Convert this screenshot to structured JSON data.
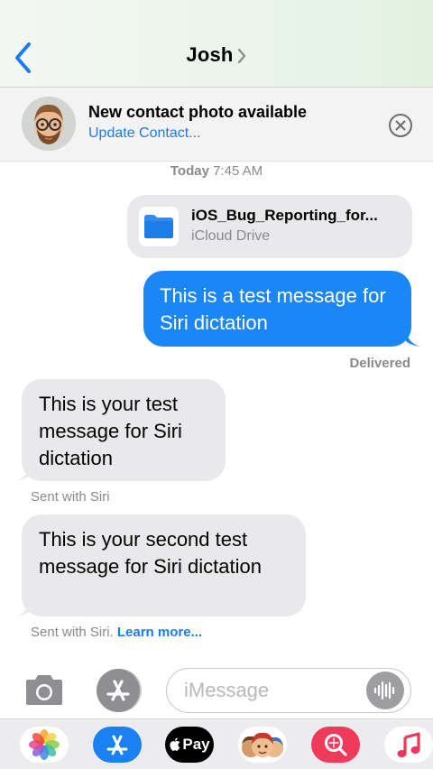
{
  "header": {
    "contact_name": "Josh"
  },
  "banner": {
    "title": "New contact photo available",
    "link": "Update Contact..."
  },
  "thread": {
    "timestamp_day": "Today",
    "timestamp_time": "7:45 AM",
    "attachment": {
      "name": "iOS_Bug_Reporting_for...",
      "source": "iCloud Drive"
    },
    "outgoing_message": "This is a test message for Siri dictation",
    "delivered_label": "Delivered",
    "incoming_messages": [
      {
        "text": "This is your test message for Siri dictation",
        "note": "Sent with Siri"
      },
      {
        "text": "This is your second test message for Siri dictation",
        "note": "Sent with Siri.",
        "link": "Learn more..."
      }
    ]
  },
  "composer": {
    "placeholder": "iMessage"
  },
  "app_drawer": {
    "apps": [
      "photos-icon",
      "app-store-icon",
      "apple-pay-icon",
      "memoji-icon",
      "images-search-icon",
      "music-icon"
    ],
    "pay_label": "Pay"
  },
  "colors": {
    "accent": "#1a7cf5",
    "outgoing_bubble": "#1b86f5",
    "incoming_bubble": "#e9e9eb"
  }
}
